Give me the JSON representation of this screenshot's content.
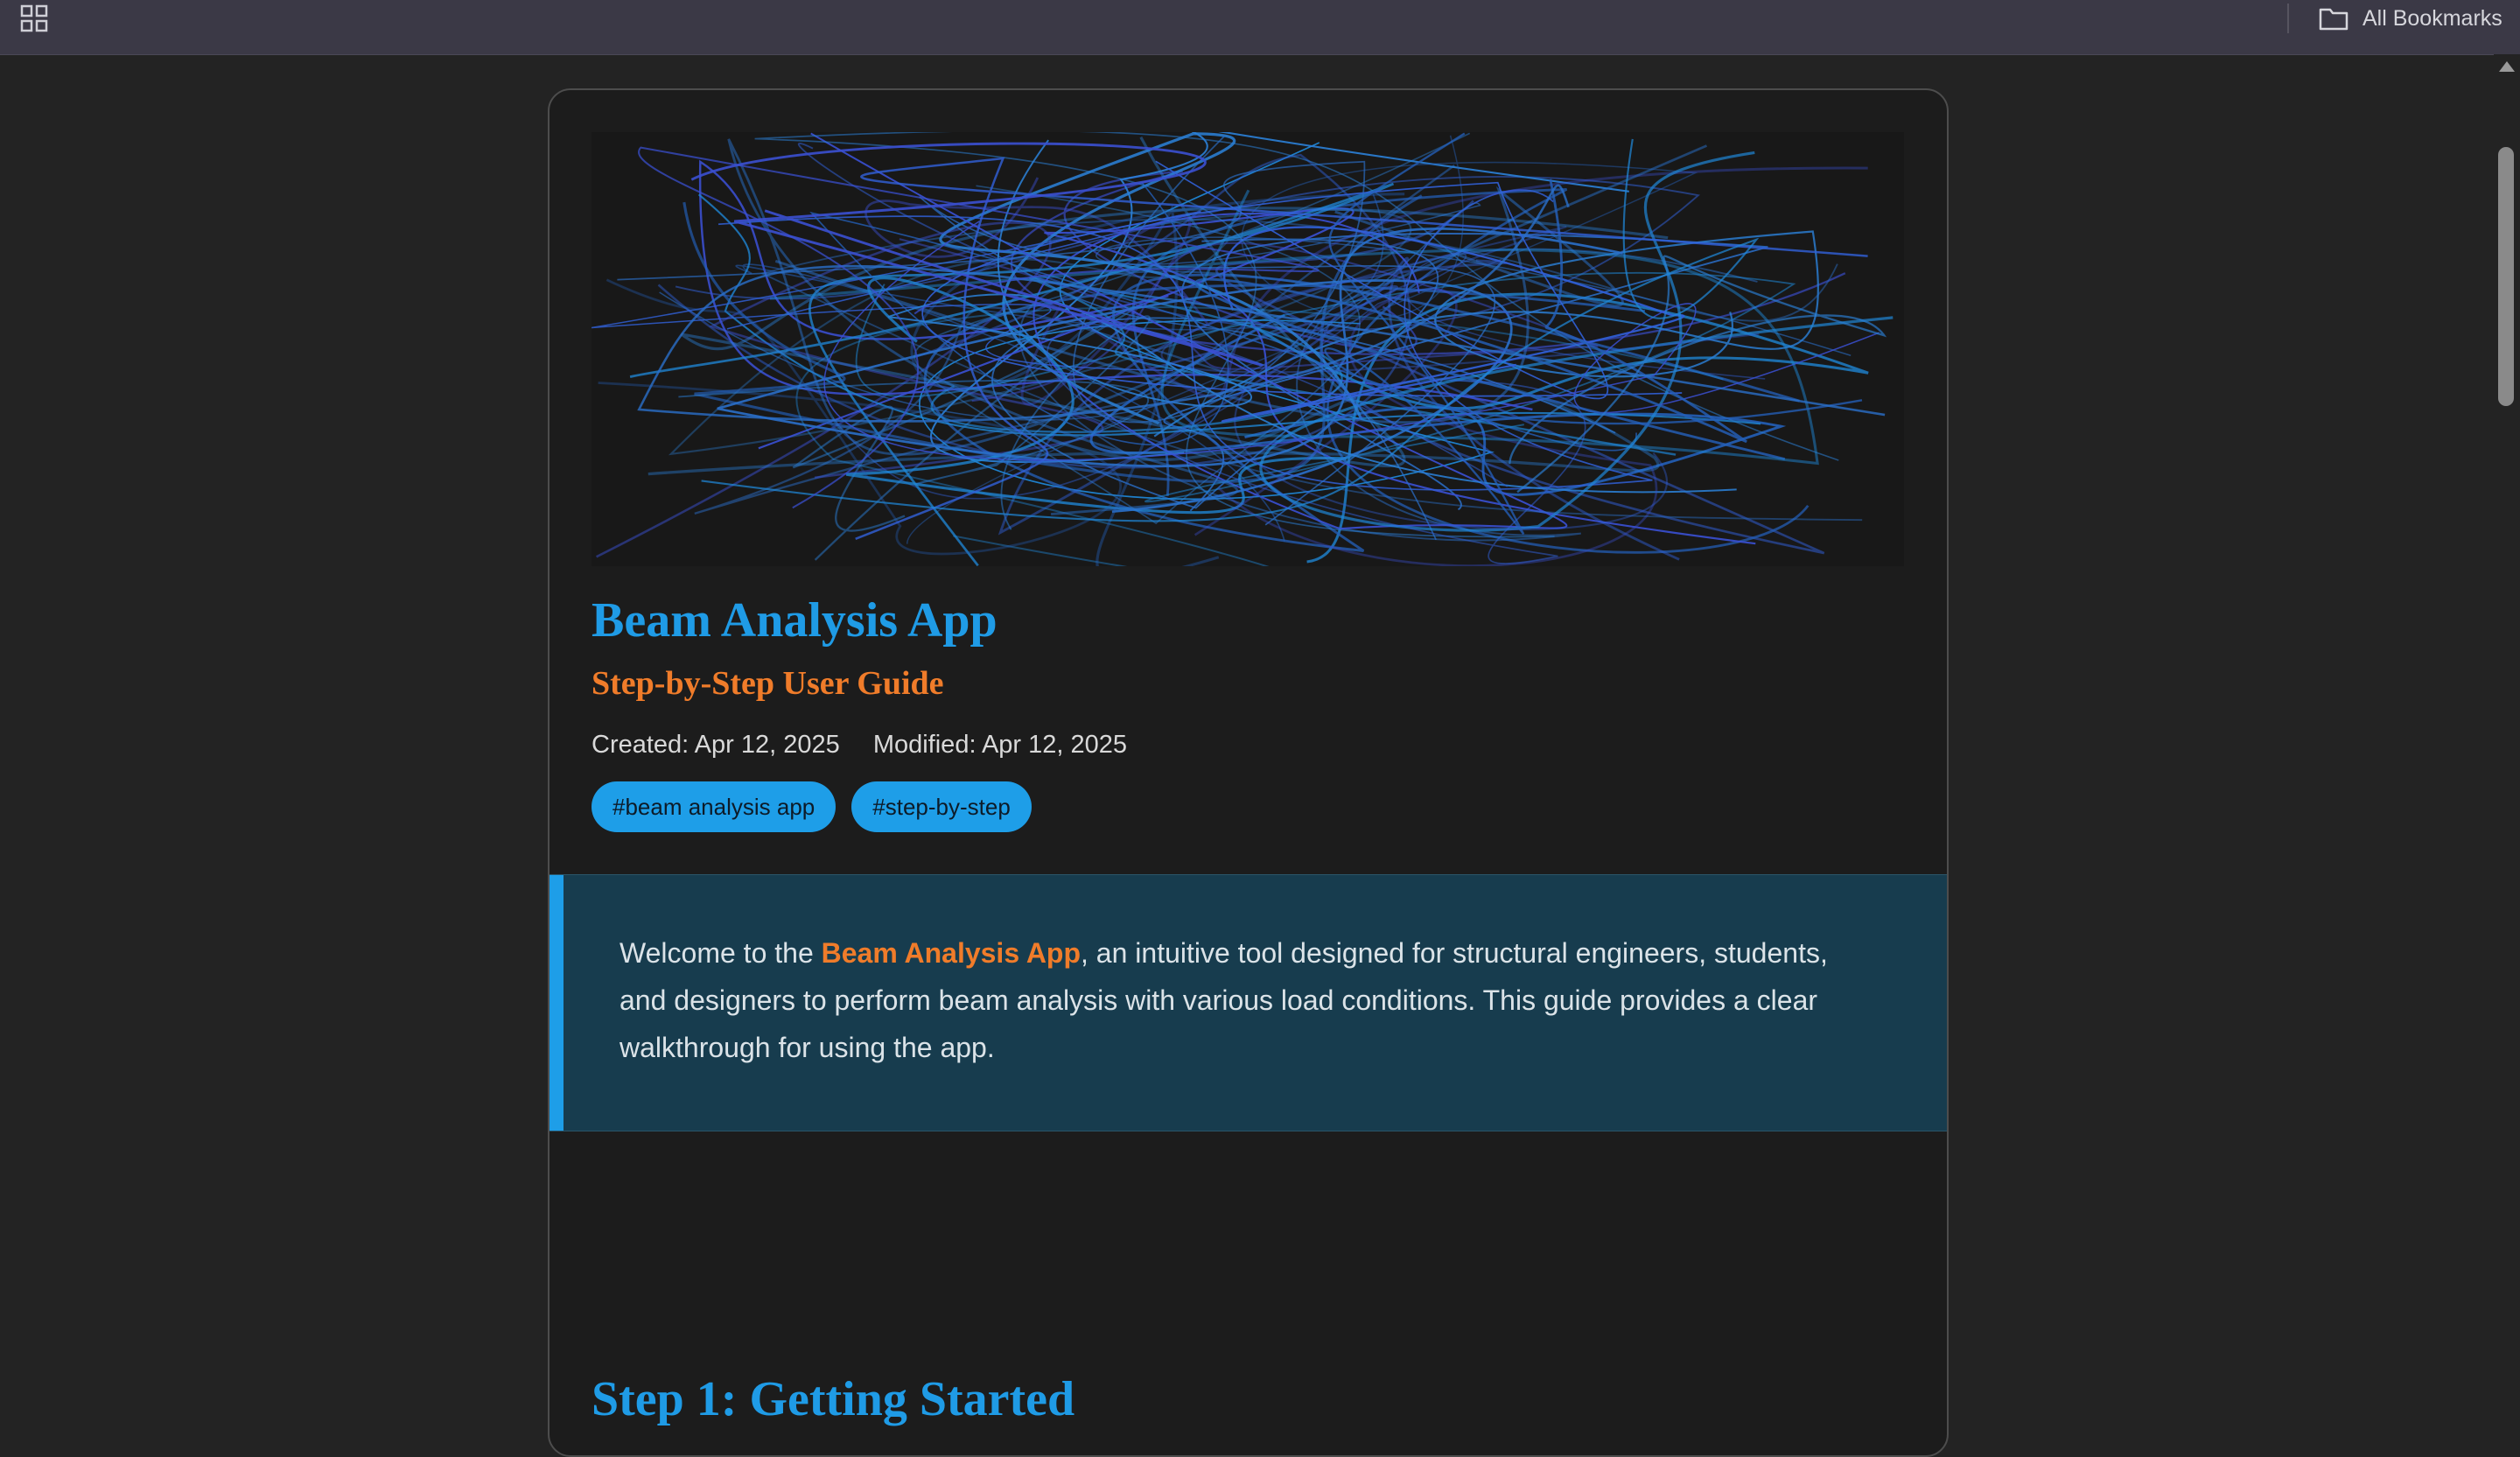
{
  "bookmarks_bar": {
    "apps_icon": "grid-icon",
    "folder_icon": "folder-icon",
    "all_bookmarks_label": "All Bookmarks"
  },
  "note": {
    "hero_image": "abstract-blue-line-art",
    "title": "Beam Analysis App",
    "subtitle": "Step-by-Step User Guide",
    "created": "Created: Apr 12, 2025",
    "modified": "Modified: Apr 12, 2025",
    "tags": [
      "#beam analysis app",
      "#step-by-step"
    ],
    "intro": {
      "prefix": "Welcome to the ",
      "highlight": "Beam Analysis App",
      "suffix": ", an intuitive tool designed for structural engineers, students, and designers to perform beam analysis with various load conditions. This guide provides a clear walkthrough for using the app."
    },
    "step1_heading": "Step 1: Getting Started"
  },
  "colors": {
    "accent_blue": "#1f9be6",
    "accent_orange": "#f07c2a",
    "intro_background": "#173c4e"
  }
}
